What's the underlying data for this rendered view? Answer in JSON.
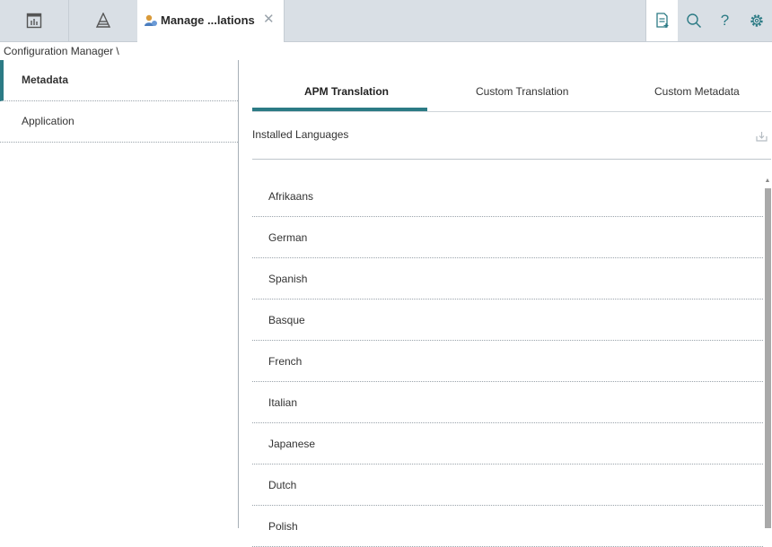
{
  "tabs_bar": {
    "active_tab_title": "Manage ...lations",
    "close_glyph": "✕",
    "icons": [
      "dashboard-icon",
      "hierarchy-icon",
      "user-settings-icon"
    ]
  },
  "toolbar": {
    "icons": [
      "new-document-icon",
      "search-icon",
      "help-icon",
      "settings-icon"
    ],
    "help_glyph": "?"
  },
  "breadcrumb": "Configuration Manager \\",
  "sidebar": {
    "items": [
      {
        "label": "Metadata",
        "active": true
      },
      {
        "label": "Application",
        "active": false
      }
    ]
  },
  "content_tabs": [
    {
      "label": "APM Translation",
      "active": true
    },
    {
      "label": "Custom Translation",
      "active": false
    },
    {
      "label": "Custom Metadata",
      "active": false
    }
  ],
  "section": {
    "title": "Installed Languages",
    "export_icon": "export-icon"
  },
  "languages": [
    "Afrikaans",
    "German",
    "Spanish",
    "Basque",
    "French",
    "Italian",
    "Japanese",
    "Dutch",
    "Polish"
  ],
  "colors": {
    "accent": "#2c7b85",
    "tabbar_bg": "#d9dfe5"
  }
}
